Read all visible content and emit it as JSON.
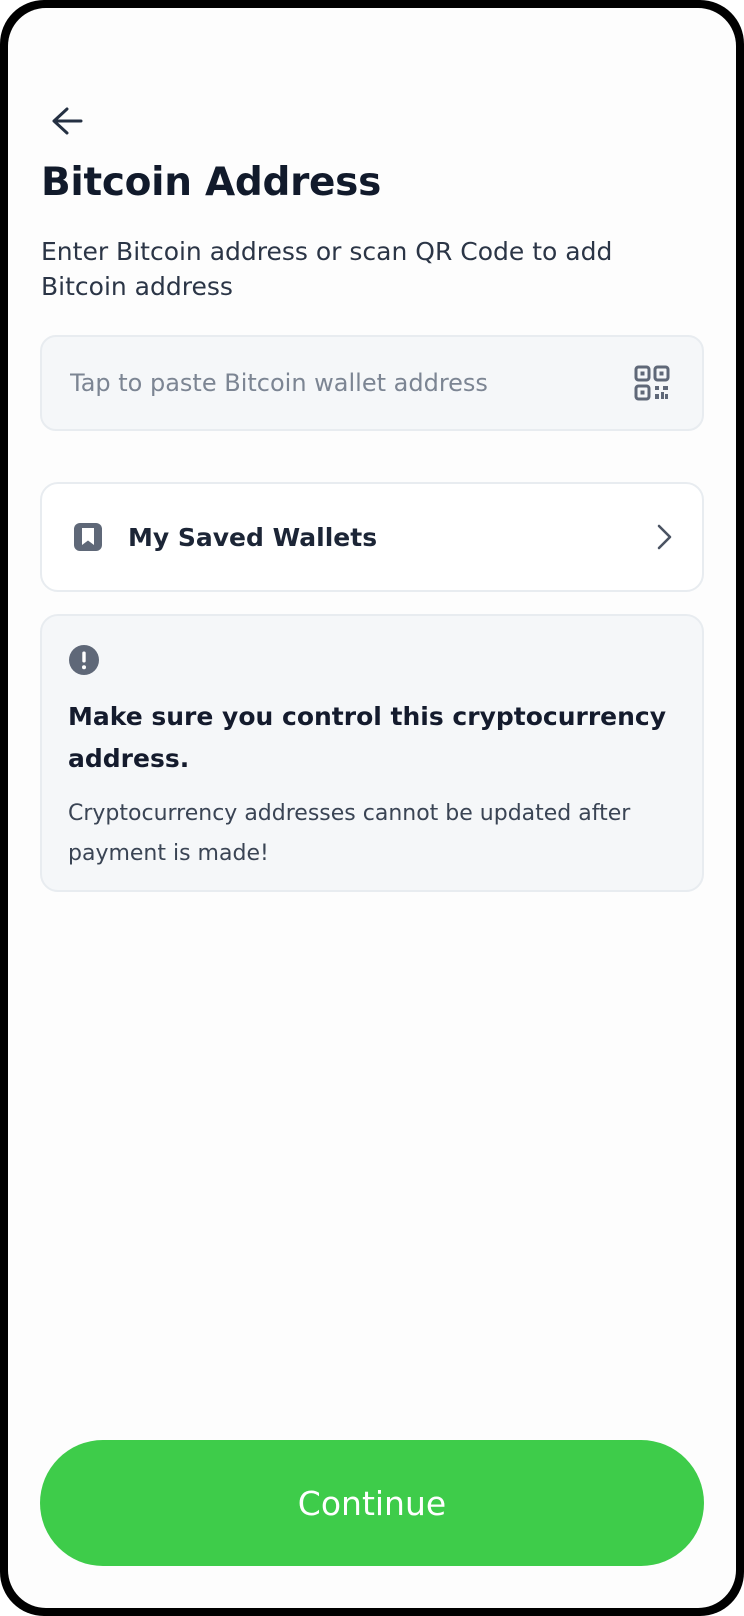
{
  "header": {
    "back_icon": "arrow-left-icon",
    "title": "Bitcoin Address",
    "subtitle": "Enter Bitcoin address or scan QR Code to add Bitcoin address"
  },
  "address_field": {
    "value": "",
    "placeholder": "Tap to paste Bitcoin wallet address",
    "scan_icon": "qr-code-icon"
  },
  "saved_wallets": {
    "icon": "bookmark-icon",
    "label": "My Saved Wallets",
    "chevron_icon": "chevron-right-icon"
  },
  "notice": {
    "icon": "exclamation-circle-icon",
    "heading": "Make sure you control this cryptocurrency address.",
    "body": "Cryptocurrency addresses cannot be updated after payment is made!"
  },
  "footer": {
    "continue_label": "Continue"
  },
  "colors": {
    "accent_green": "#3ecc4a",
    "text_dark": "#111a2b",
    "field_bg": "#f5f7f9",
    "icon_gray": "#5f6878"
  }
}
